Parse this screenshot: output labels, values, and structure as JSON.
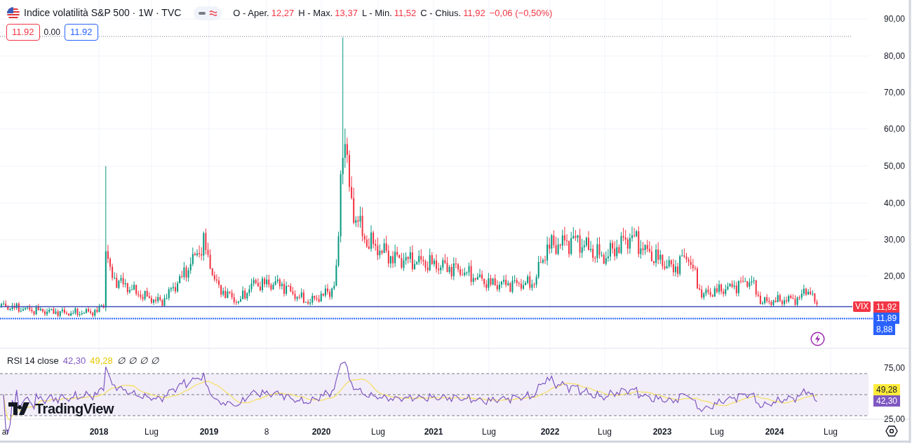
{
  "header": {
    "title": "Indice volatilità S&P 500 · 1W · TVC",
    "ohlc": [
      {
        "label": "O - Aper.",
        "value": "12,27"
      },
      {
        "label": "H - Max.",
        "value": "13,37"
      },
      {
        "label": "L - Min.",
        "value": "11,52"
      },
      {
        "label": "C - Chius.",
        "value": "11,92"
      }
    ],
    "change": "−0,06 (−0,50%)"
  },
  "trade": {
    "sell": "11.92",
    "spread": "0.00",
    "buy": "11.92"
  },
  "price_axis": {
    "ticks": [
      "90,00",
      "80,00",
      "70,00",
      "60,00",
      "50,00",
      "40,00",
      "30,00",
      "20,00"
    ],
    "tags": [
      {
        "text": "11,92",
        "color": "#f23645"
      },
      {
        "text": "11,89",
        "color": "#2962ff"
      },
      {
        "text": "8,88",
        "color": "#2962ff"
      }
    ],
    "symbol_tag": "VIX"
  },
  "rsi": {
    "title": "RSI 14 close",
    "value": "42,30",
    "ma_value": "49,28",
    "extras": [
      "∅",
      "∅",
      "∅",
      "∅"
    ],
    "ticks": [
      "75,00",
      "25,00"
    ],
    "tags": [
      {
        "text": "49,28",
        "color": "#ffeb3b"
      },
      {
        "text": "42,30",
        "color": "#7e57c2"
      }
    ]
  },
  "logo": "TradingView",
  "time_axis": [
    "ar",
    "2018",
    "Lug",
    "2019",
    "8",
    "2020",
    "Lug",
    "2021",
    "Lug",
    "2022",
    "Lug",
    "2023",
    "Lug",
    "2024",
    "Lug"
  ]
}
